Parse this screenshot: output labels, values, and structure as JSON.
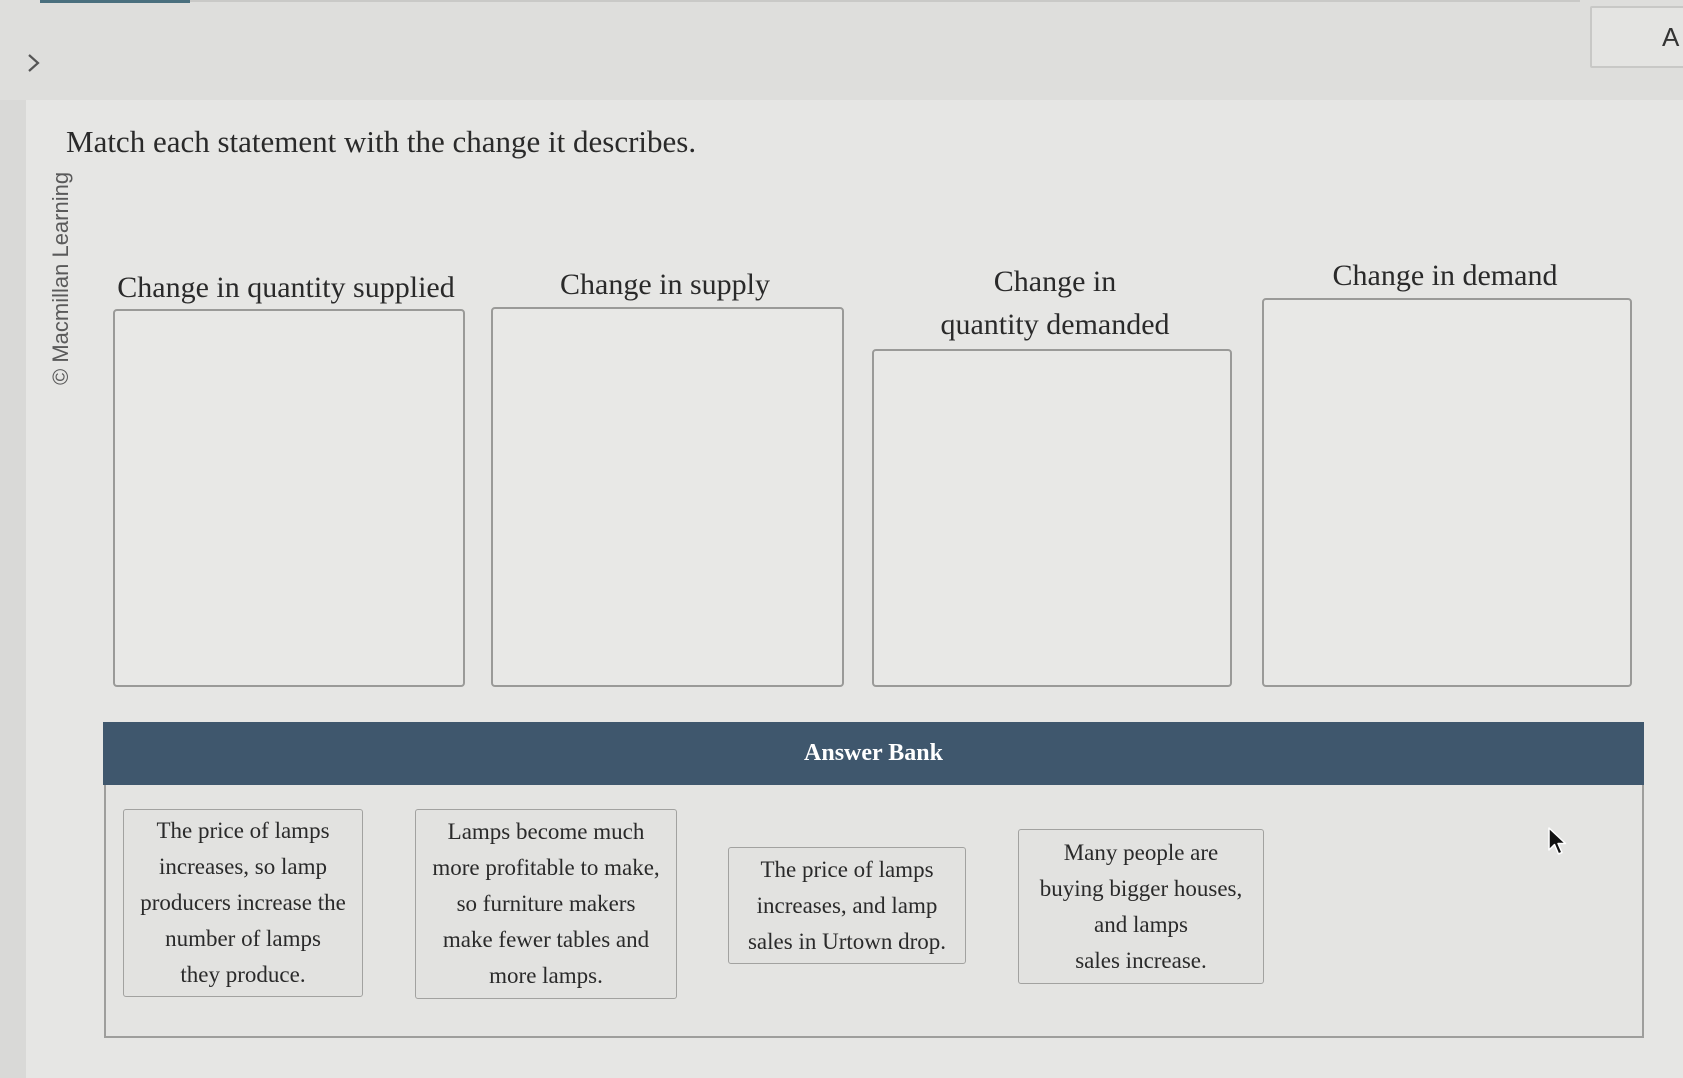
{
  "header": {
    "corner_text": "A"
  },
  "credit": "© Macmillan Learning",
  "prompt": "Match each statement with the change it describes.",
  "categories": [
    {
      "label": "Change in quantity supplied"
    },
    {
      "label": "Change in supply"
    },
    {
      "label": "Change in\nquantity demanded"
    },
    {
      "label": "Change in demand"
    }
  ],
  "answer_bank": {
    "title": "Answer Bank",
    "cards": [
      {
        "text": "The price of lamps\nincreases, so lamp\nproducers increase the\nnumber of lamps\nthey produce."
      },
      {
        "text": "Lamps become much\nmore profitable to make,\nso furniture makers\nmake fewer tables and\nmore lamps."
      },
      {
        "text": "The price of lamps\nincreases, and lamp\nsales in Urtown drop."
      },
      {
        "text": "Many people are\nbuying bigger houses,\nand lamps\nsales increase."
      }
    ]
  },
  "icons": {
    "chevron": "chevron-right-icon",
    "cursor": "mouse-pointer-icon"
  }
}
